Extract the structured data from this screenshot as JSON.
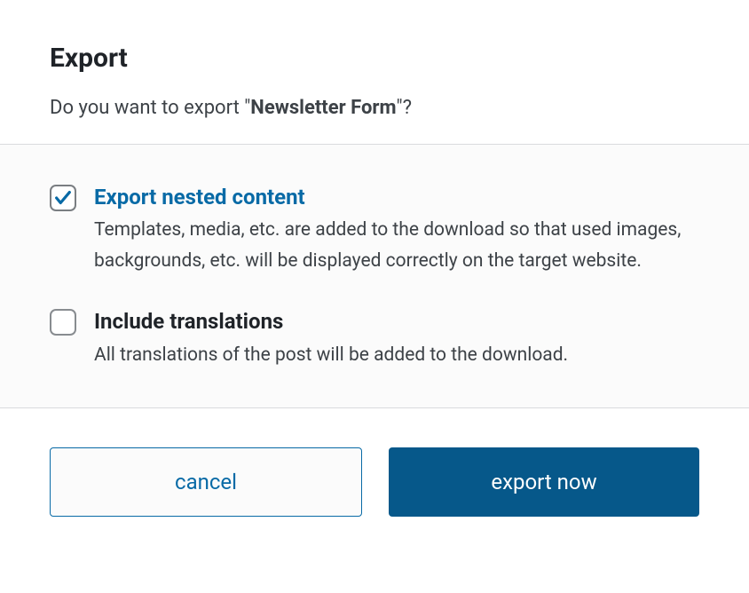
{
  "dialog": {
    "title": "Export",
    "subtitle_prefix": "Do you want to export \"",
    "subtitle_item": "Newsletter Form",
    "subtitle_suffix": "\"?"
  },
  "options": {
    "nested": {
      "checked": true,
      "label": "Export nested content",
      "description": "Templates, media, etc. are added to the download so that used images, backgrounds, etc. will be displayed correctly on the target website."
    },
    "translations": {
      "checked": false,
      "label": "Include translations",
      "description": "All translations of the post will be added to the download."
    }
  },
  "buttons": {
    "cancel": "cancel",
    "export": "export now"
  },
  "colors": {
    "accent": "#086aa6",
    "primary": "#06588a"
  }
}
